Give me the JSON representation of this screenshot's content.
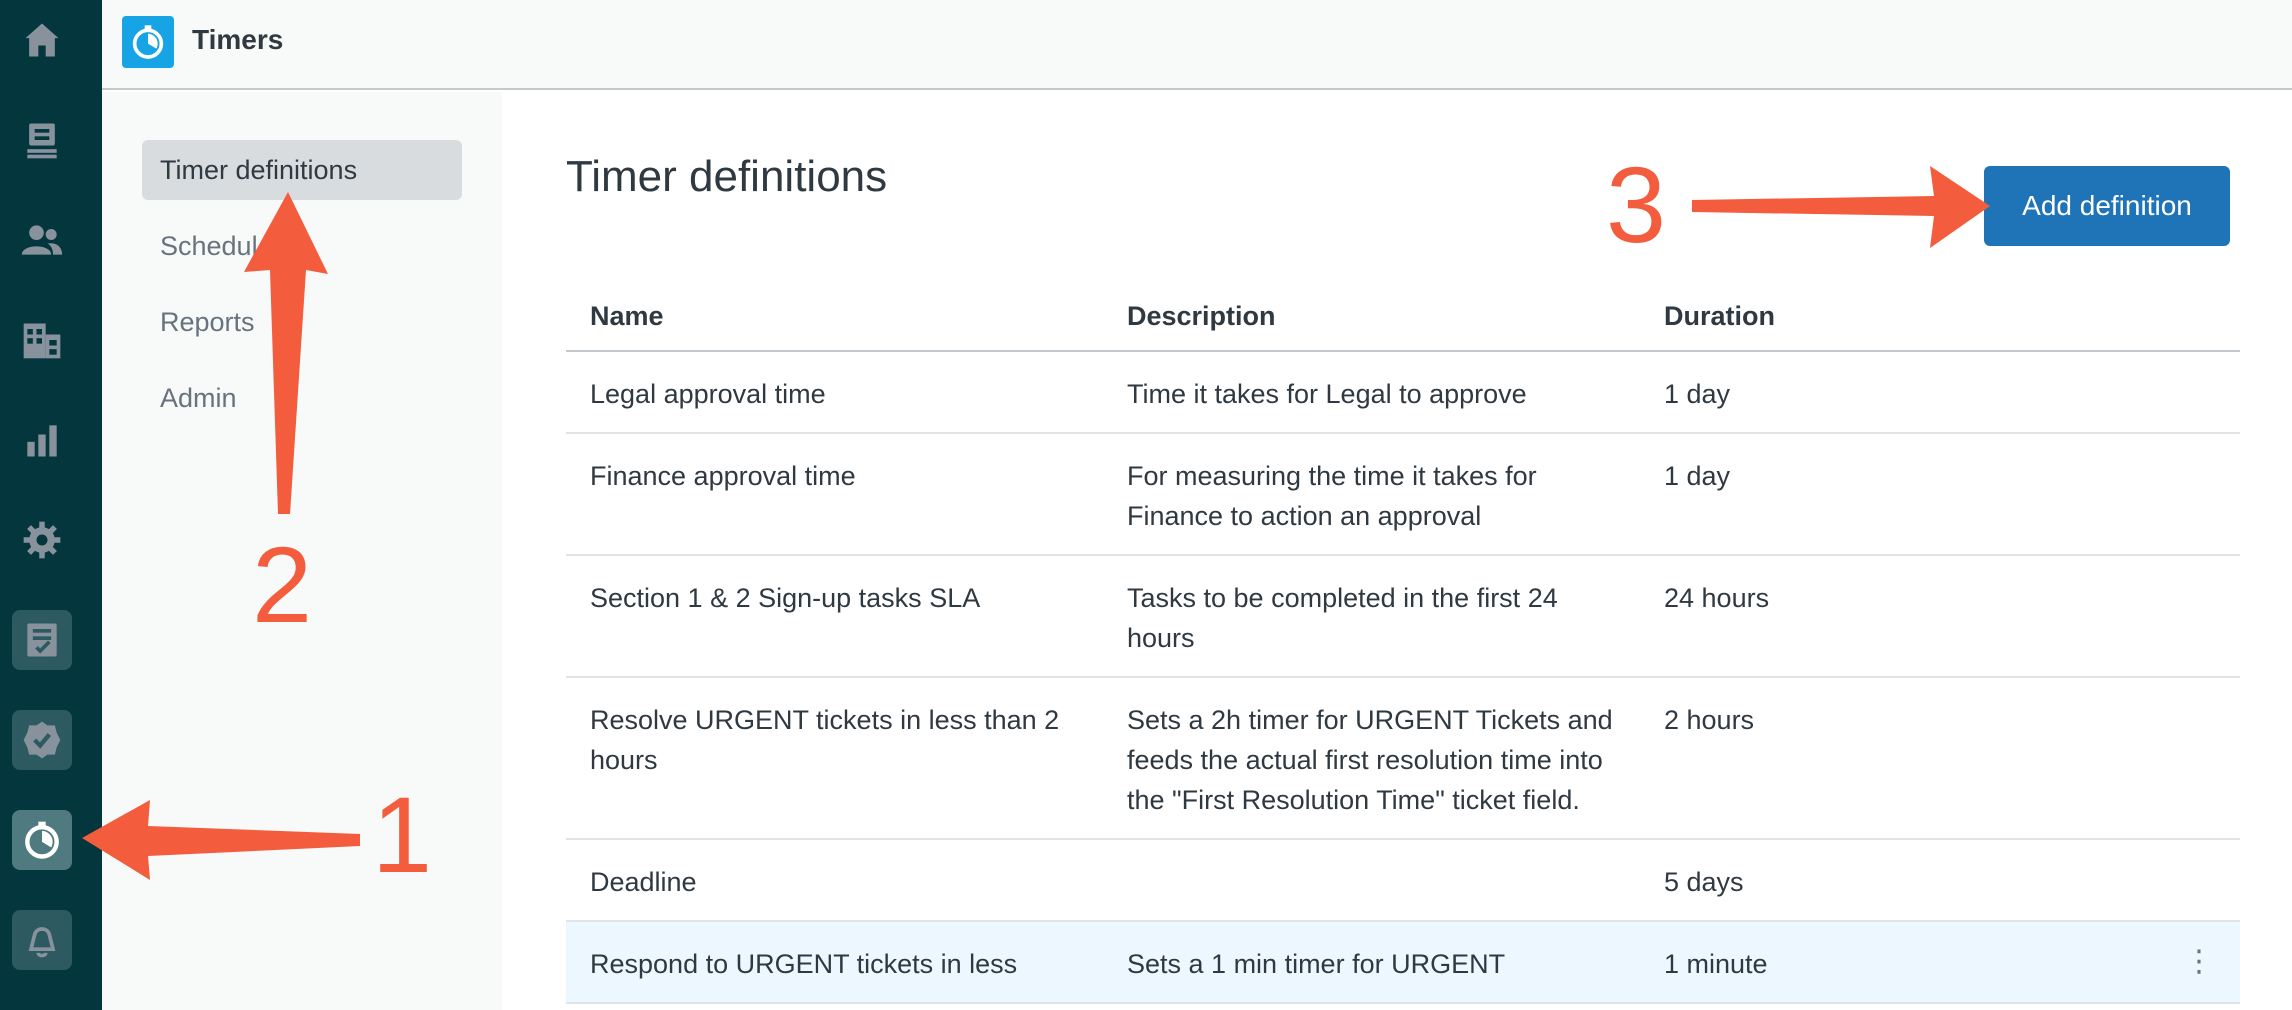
{
  "rail": {
    "items": [
      "home-icon",
      "views-icon",
      "users-icon",
      "organizations-icon",
      "reporting-icon",
      "settings-icon",
      "tasks-app-icon",
      "approvals-app-icon",
      "timers-app-icon",
      "bell-app-icon"
    ]
  },
  "header": {
    "title": "Timers"
  },
  "subnav": {
    "items": [
      {
        "label": "Timer definitions"
      },
      {
        "label": "Schedul"
      },
      {
        "label": "Reports"
      },
      {
        "label": "Admin"
      }
    ]
  },
  "main": {
    "title": "Timer definitions",
    "add_button": "Add definition",
    "columns": [
      "Name",
      "Description",
      "Duration"
    ],
    "rows": [
      {
        "name": "Legal approval time",
        "description": "Time it takes for Legal to approve",
        "duration": "1 day"
      },
      {
        "name": "Finance approval time",
        "description": "For measuring the time it takes for Finance to action an approval",
        "duration": "1 day"
      },
      {
        "name": "Section 1 & 2 Sign-up tasks SLA",
        "description": "Tasks to be completed in the first 24 hours",
        "duration": "24 hours"
      },
      {
        "name": "Resolve URGENT tickets in less than 2 hours",
        "description": "Sets a 2h timer for URGENT Tickets and feeds the actual first resolution time into the \"First Resolution Time\" ticket field.",
        "duration": "2 hours"
      },
      {
        "name": "Deadline",
        "description": "",
        "duration": "5 days"
      },
      {
        "name": "Respond to URGENT tickets in less",
        "description": "Sets a 1 min timer for URGENT",
        "duration": "1 minute"
      }
    ],
    "more_icon": "⋮"
  },
  "annotations": {
    "labels": [
      "1",
      "2",
      "3"
    ],
    "color": "#f35c3d"
  },
  "colors": {
    "rail": "#03363d",
    "accent": "#1f73b7",
    "annotation": "#f35c3d"
  }
}
